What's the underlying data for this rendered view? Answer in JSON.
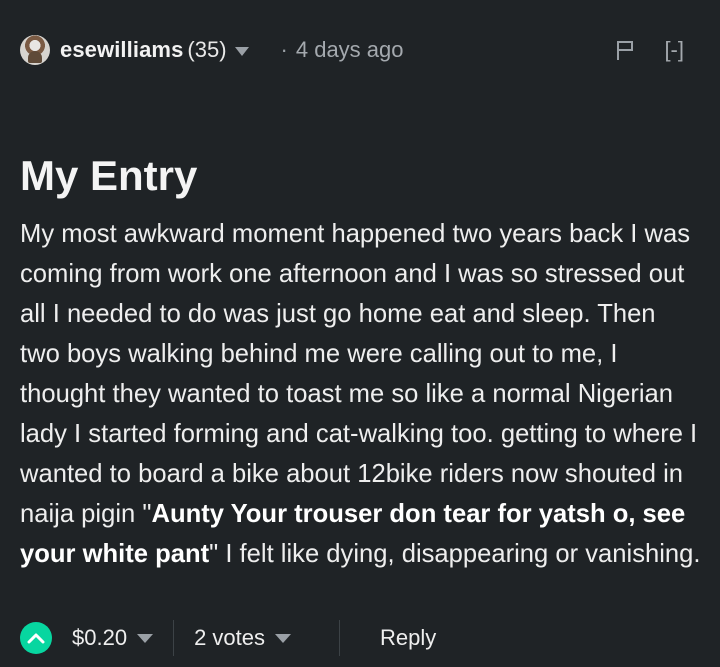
{
  "header": {
    "author": "esewilliams",
    "reputation": "(35)",
    "separator": "·",
    "time": "4 days ago",
    "collapse_label": "[-]",
    "icons": [
      "avatar",
      "chevron-down-icon",
      "flag-icon"
    ]
  },
  "post": {
    "title": "My Entry",
    "body_part1": "My most awkward moment happened two years back I was coming from work one afternoon and I was so stressed out all I needed to do was just go home eat and sleep. Then two boys walking behind me were calling out to me, I thought they wanted to toast me so like a normal Nigerian lady I started forming and cat-walking too. getting to where I wanted to board a bike about 12bike riders now shouted in naija pigin \"",
    "body_bold": "Aunty Your trouser don tear for yatsh o, see your white pant",
    "body_part2": "\" I felt like dying, disappearing or vanishing."
  },
  "footer": {
    "payout": "$0.20",
    "votes": "2 votes",
    "reply": "Reply",
    "icons": [
      "upvote-icon",
      "chevron-down-icon"
    ]
  },
  "colors": {
    "background": "#1f2326",
    "accent": "#07d6a0",
    "muted": "#a4a9ae"
  }
}
